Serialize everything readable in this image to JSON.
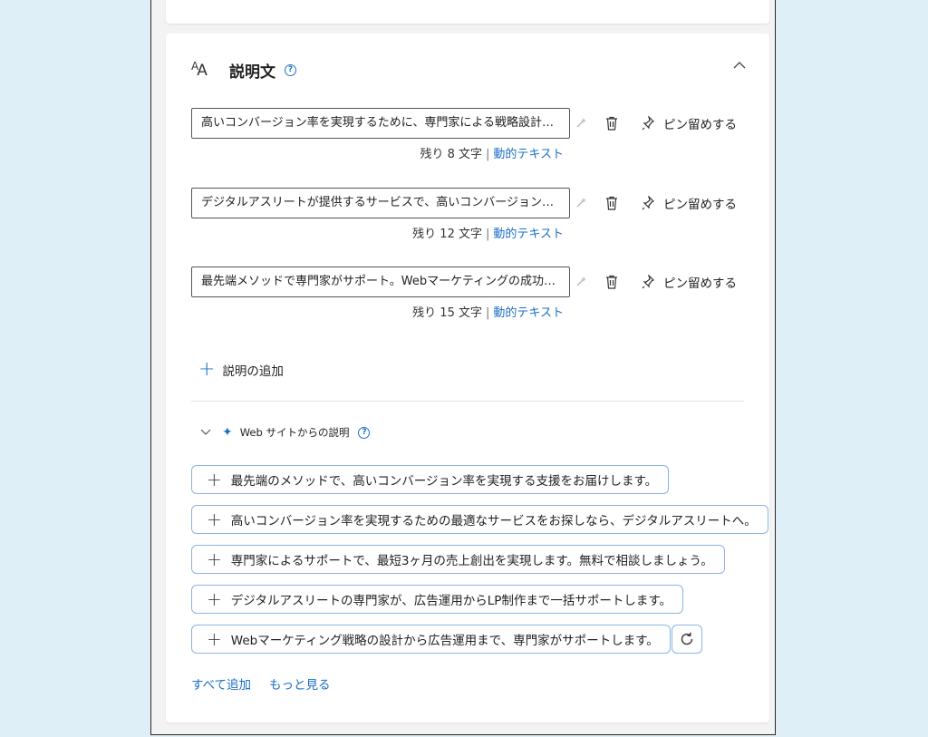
{
  "section": {
    "title": "説明文",
    "help": "?"
  },
  "descriptions": [
    {
      "value": "高いコンバージョン率を実現するために、専門家による戦略設計…",
      "pin_label": "ピン留めする",
      "remaining": "残り 8 文字",
      "dynamic_link": "動的テキスト"
    },
    {
      "value": "デジタルアスリートが提供するサービスで、高いコンバージョン率を…",
      "pin_label": "ピン留めする",
      "remaining": "残り 12 文字",
      "dynamic_link": "動的テキスト"
    },
    {
      "value": "最先端メソッドで専門家がサポート。Webマーケティングの成功を…",
      "pin_label": "ピン留めする",
      "remaining": "残り 15 文字",
      "dynamic_link": "動的テキスト"
    }
  ],
  "add_description_label": "説明の追加",
  "suggestions": {
    "title": "Web サイトからの説明",
    "help": "?",
    "items": [
      "最先端のメソッドで、高いコンバージョン率を実現する支援をお届けします。",
      "高いコンバージョン率を実現するための最適なサービスをお探しなら、デジタルアスリートへ。",
      "専門家によるサポートで、最短3ヶ月の売上創出を実現します。無料で相談しましょう。",
      "デジタルアスリートの専門家が、広告運用からLP制作まで一括サポートします。",
      "Webマーケティング戦略の設計から広告運用まで、専門家がサポートします。"
    ],
    "add_all": "すべて追加",
    "see_more": "もっと見る"
  },
  "colors": {
    "accent": "#1a73c8",
    "chip_border": "#8ab4e6",
    "background": "#deeff7"
  }
}
